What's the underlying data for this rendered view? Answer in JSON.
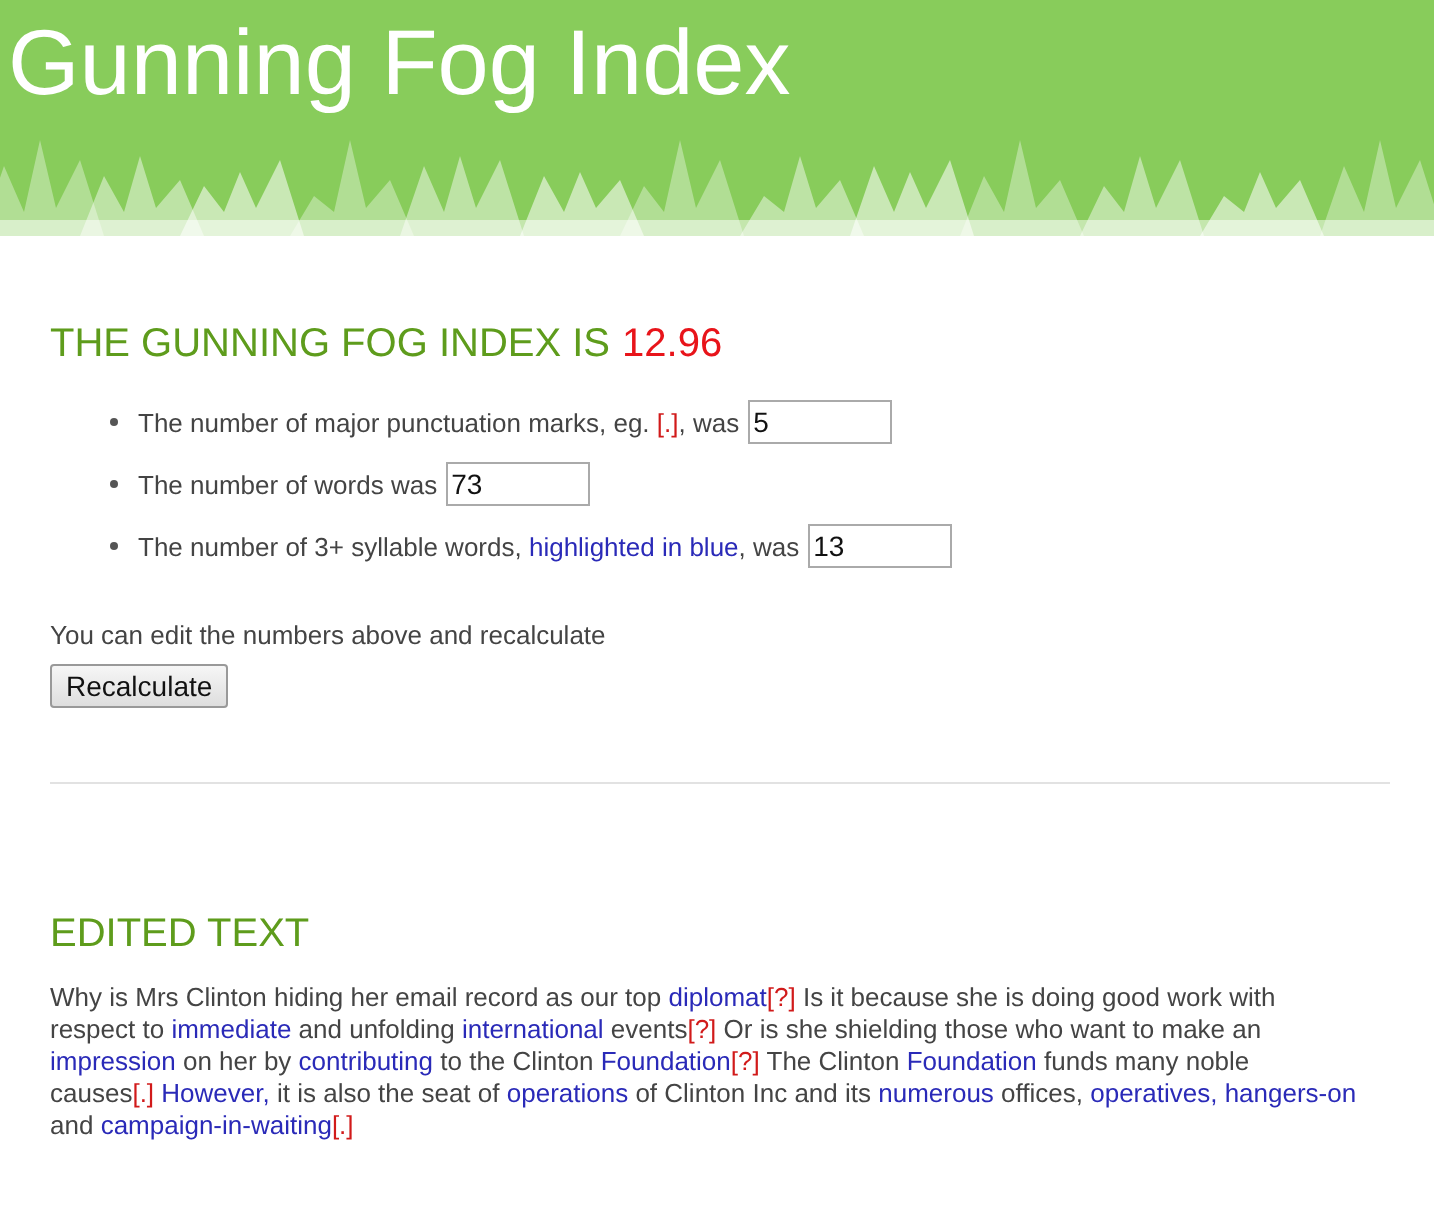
{
  "header": {
    "title": "Gunning Fog Index"
  },
  "result": {
    "label": "THE GUNNING FOG INDEX IS",
    "value": "12.96"
  },
  "counts": [
    {
      "segments": [
        {
          "kind": "plain",
          "text": "The number of major punctuation marks, eg. "
        },
        {
          "kind": "mark",
          "text": "[.]"
        },
        {
          "kind": "plain",
          "text": ", was"
        }
      ],
      "value": "5"
    },
    {
      "segments": [
        {
          "kind": "plain",
          "text": "The number of words was"
        }
      ],
      "value": "73"
    },
    {
      "segments": [
        {
          "kind": "plain",
          "text": "The number of 3+ syllable words, "
        },
        {
          "kind": "long",
          "text": "highlighted in blue"
        },
        {
          "kind": "plain",
          "text": ", was"
        }
      ],
      "value": "13"
    }
  ],
  "hint": "You can edit the numbers above and recalculate",
  "button": "Recalculate",
  "edited": {
    "title": "EDITED TEXT",
    "segments": [
      {
        "kind": "plain",
        "text": "Why is Mrs Clinton hiding her email record as our top "
      },
      {
        "kind": "long",
        "text": "diplomat"
      },
      {
        "kind": "mark",
        "text": "[?]"
      },
      {
        "kind": "plain",
        "text": " Is it because she is doing good work with respect to "
      },
      {
        "kind": "long",
        "text": "immediate"
      },
      {
        "kind": "plain",
        "text": " and unfolding "
      },
      {
        "kind": "long",
        "text": "international"
      },
      {
        "kind": "plain",
        "text": " events"
      },
      {
        "kind": "mark",
        "text": "[?]"
      },
      {
        "kind": "plain",
        "text": " Or is she shielding those who want to make an "
      },
      {
        "kind": "long",
        "text": "impression"
      },
      {
        "kind": "plain",
        "text": " on her by "
      },
      {
        "kind": "long",
        "text": "contributing"
      },
      {
        "kind": "plain",
        "text": " to the Clinton "
      },
      {
        "kind": "long",
        "text": "Foundation"
      },
      {
        "kind": "mark",
        "text": "[?]"
      },
      {
        "kind": "plain",
        "text": " The Clinton "
      },
      {
        "kind": "long",
        "text": "Foundation"
      },
      {
        "kind": "plain",
        "text": " funds many noble causes"
      },
      {
        "kind": "mark",
        "text": "[.]"
      },
      {
        "kind": "long",
        "text": " However,"
      },
      {
        "kind": "plain",
        "text": " it is also the seat of "
      },
      {
        "kind": "long",
        "text": "operations"
      },
      {
        "kind": "plain",
        "text": " of Clinton Inc and its "
      },
      {
        "kind": "long",
        "text": "numerous"
      },
      {
        "kind": "plain",
        "text": " offices, "
      },
      {
        "kind": "long",
        "text": "operatives,"
      },
      {
        "kind": "long",
        "text": " hangers-on"
      },
      {
        "kind": "plain",
        "text": " and "
      },
      {
        "kind": "long",
        "text": "campaign-in-waiting"
      },
      {
        "kind": "mark",
        "text": "[.]"
      }
    ]
  }
}
